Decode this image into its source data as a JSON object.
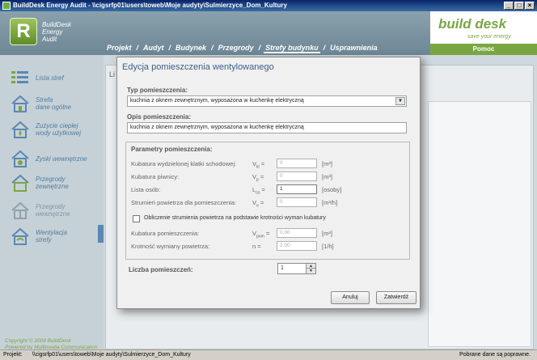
{
  "window": {
    "title": "BuildDesk Energy Audit - \\\\cigsrfp01\\users\\toweb\\Moje audyty\\Sulmierzyce_Dom_Kultury"
  },
  "logo": {
    "line1": "BuildDesk",
    "line2": "Energy",
    "line3": "Audit"
  },
  "nav": {
    "items": [
      "Projekt",
      "Audyt",
      "Budynek",
      "Przegrody",
      "Strefy budynku",
      "Usprawnienia"
    ],
    "separator": "/"
  },
  "brand": {
    "name": "build desk",
    "tagline": "save your energy",
    "help": "Pomoc"
  },
  "sidebar": {
    "items": [
      {
        "label": "Lista stref"
      },
      {
        "label": "Strefa\ndane ogólne"
      },
      {
        "label": "Zużycie ciepłej\nwody użytkowej"
      },
      {
        "label": "Zyski wewnętrzne"
      },
      {
        "label": "Przegrody\nzewnętrzne"
      },
      {
        "label": "Przegrody\nwewnętrzne"
      },
      {
        "label": "Wentylacja\nstrefy"
      }
    ],
    "copyright1": "Copyright © 2009 BuildDesk",
    "copyright2": "Powered by Multimedia Communication"
  },
  "content": {
    "label": "Li"
  },
  "dialog": {
    "title": "Edycja pomieszczenia wentylowanego",
    "type_label": "Typ pomieszczenia:",
    "type_value": "kuchnia z oknem zewnętrznym, wyposażona w kuchenkę elektryczną",
    "desc_label": "Opis pomieszczenia:",
    "desc_value": "kuchnia z oknem zewnętrznym, wyposażona w kuchenkę elektryczną",
    "params_title": "Parametry pomieszczenia:",
    "params": [
      {
        "label": "Kubatura wydzielonej klatki schodowej:",
        "sym": "V",
        "sub": "kl",
        "value": "0",
        "unit": "[m³]"
      },
      {
        "label": "Kubatura piwnicy:",
        "sym": "V",
        "sub": "p",
        "value": "0",
        "unit": "[m³]"
      },
      {
        "label": "Lista osób:",
        "sym": "L",
        "sub": "os",
        "value": "1",
        "unit": "[osoby]"
      },
      {
        "label": "Strumień powietrza dla pomieszczenia:",
        "sym": "V",
        "sub": "o",
        "value": "0",
        "unit": "[m³/h]"
      }
    ],
    "checkbox_label": "Obliczenie strumienia powietrza na podstawie krotności wyman kubatury",
    "params2": [
      {
        "label": "Kubatura pomieszczenia:",
        "sym": "V",
        "sub": "pom",
        "value": "0.00",
        "unit": "[m³]"
      },
      {
        "label": "Krotność wymiany powietrza:",
        "sym": "n",
        "sub": "",
        "value": "1.00",
        "unit": "[1/h]"
      }
    ],
    "count_label": "Liczba pomieszczeń:",
    "count_value": "1",
    "cancel": "Anuluj",
    "ok": "Zatwierdź"
  },
  "status": {
    "prefix": "Projekt:",
    "path": "\\\\cigsrfp01\\users\\toweb\\Moje audyty\\Sulmierzyce_Dom_Kultury",
    "right": "Pobrane dane są poprawne."
  }
}
